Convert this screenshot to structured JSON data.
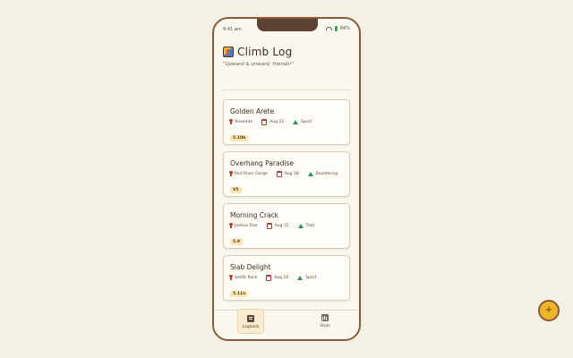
{
  "status": {
    "time": "9:41 am",
    "battery": "84%"
  },
  "header": {
    "title": "Climb Log",
    "subtitle": "\"Upward & onward, friends!\""
  },
  "climbs": [
    {
      "name": "Golden Arete",
      "location": "Yosemite",
      "date": "Aug 22",
      "style": "Sport",
      "grade": "5.10b"
    },
    {
      "name": "Overhang Paradise",
      "location": "Red River Gorge",
      "date": "Aug 18",
      "style": "Bouldering",
      "grade": "V5"
    },
    {
      "name": "Morning Crack",
      "location": "Joshua Tree",
      "date": "Aug 15",
      "style": "Trad",
      "grade": "5.9"
    },
    {
      "name": "Slab Delight",
      "location": "Smith Rock",
      "date": "Aug 10",
      "style": "Sport",
      "grade": "5.11a"
    }
  ],
  "nav": {
    "logbook_label": "Logbook",
    "stats_label": "Stats"
  },
  "fab": {
    "label": "+"
  },
  "colors": {
    "accent": "#f0b429",
    "border": "#8a5a35",
    "background": "#f5f0e6"
  }
}
